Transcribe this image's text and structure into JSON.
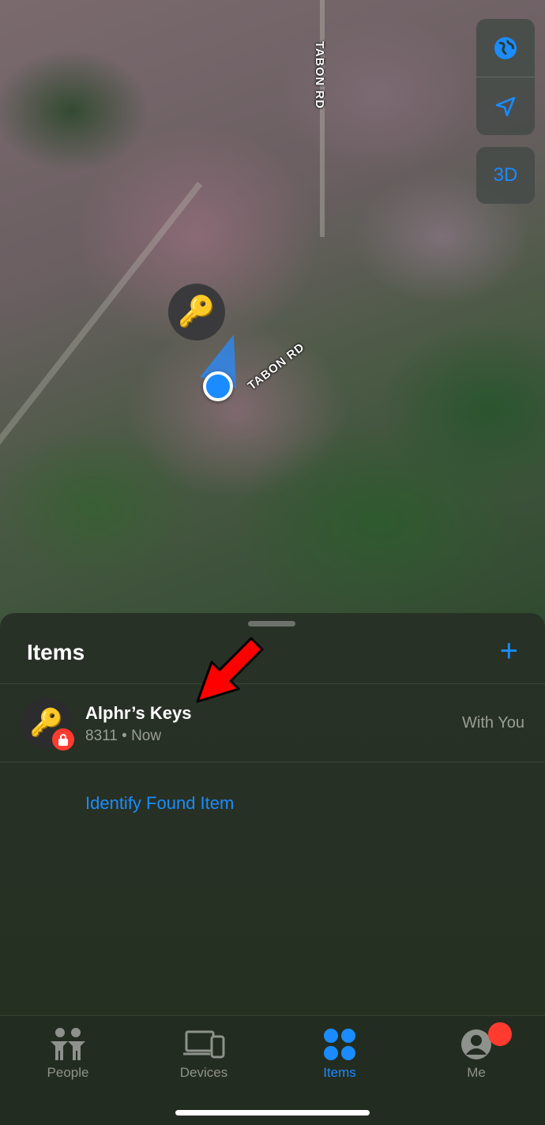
{
  "map": {
    "road_label_vertical": "TABON RD",
    "road_label_diagonal": "TABON RD",
    "buttons": {
      "globe_icon": "globe-icon",
      "location_icon": "location-arrow-icon",
      "three_d_label": "3D"
    },
    "pin_icon": "key-icon"
  },
  "sheet": {
    "title": "Items",
    "add_label": "+",
    "items": [
      {
        "name": "Alphr’s Keys",
        "subtitle": "8311 • Now",
        "status": "With You",
        "icon": "key-icon",
        "badge_icon": "lock-icon"
      }
    ],
    "identify_link": "Identify Found Item"
  },
  "tabbar": {
    "tabs": [
      {
        "label": "People",
        "icon": "people-icon",
        "active": false
      },
      {
        "label": "Devices",
        "icon": "devices-icon",
        "active": false
      },
      {
        "label": "Items",
        "icon": "items-grid-icon",
        "active": true
      },
      {
        "label": "Me",
        "icon": "person-circle-icon",
        "active": false
      }
    ]
  },
  "colors": {
    "accent": "#1a8cff",
    "badge_red": "#ff3b30",
    "annotation_arrow": "#ff0000"
  }
}
